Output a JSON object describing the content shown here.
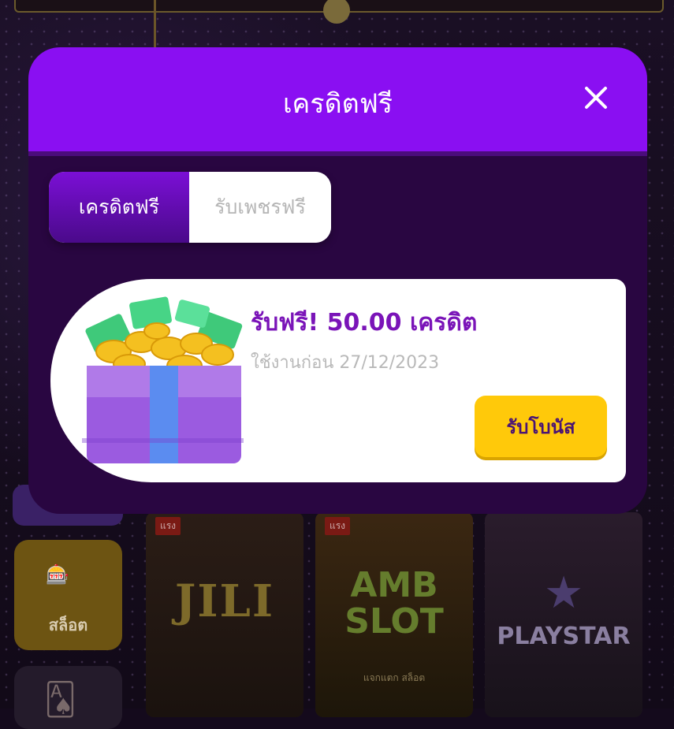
{
  "background": {
    "category": {
      "label": "สล็อต",
      "icon": "slot-icon"
    },
    "games": [
      {
        "tag": "แรง",
        "logo": "JILI"
      },
      {
        "tag": "แรง",
        "logo": "AMB SLOT",
        "sub": "แจกแตก สล็อต"
      },
      {
        "tag": "",
        "logo": "PLAYSTAR"
      }
    ]
  },
  "modal": {
    "title": "เครดิตฟรี",
    "close_icon": "close-icon",
    "tabs": [
      {
        "label": "เครดิตฟรี",
        "active": true
      },
      {
        "label": "รับเพชรฟรี",
        "active": false
      }
    ],
    "bonus": {
      "title": "รับฟรี! 50.00 เครดิต",
      "expiry": "ใช้งานก่อน 27/12/2023",
      "button": "รับโบนัส",
      "icon": "gift-box-icon"
    }
  },
  "colors": {
    "header": "#8a0ff2",
    "modal_body": "#290641",
    "accent_text": "#7a14b8",
    "button": "#ffc90a"
  }
}
